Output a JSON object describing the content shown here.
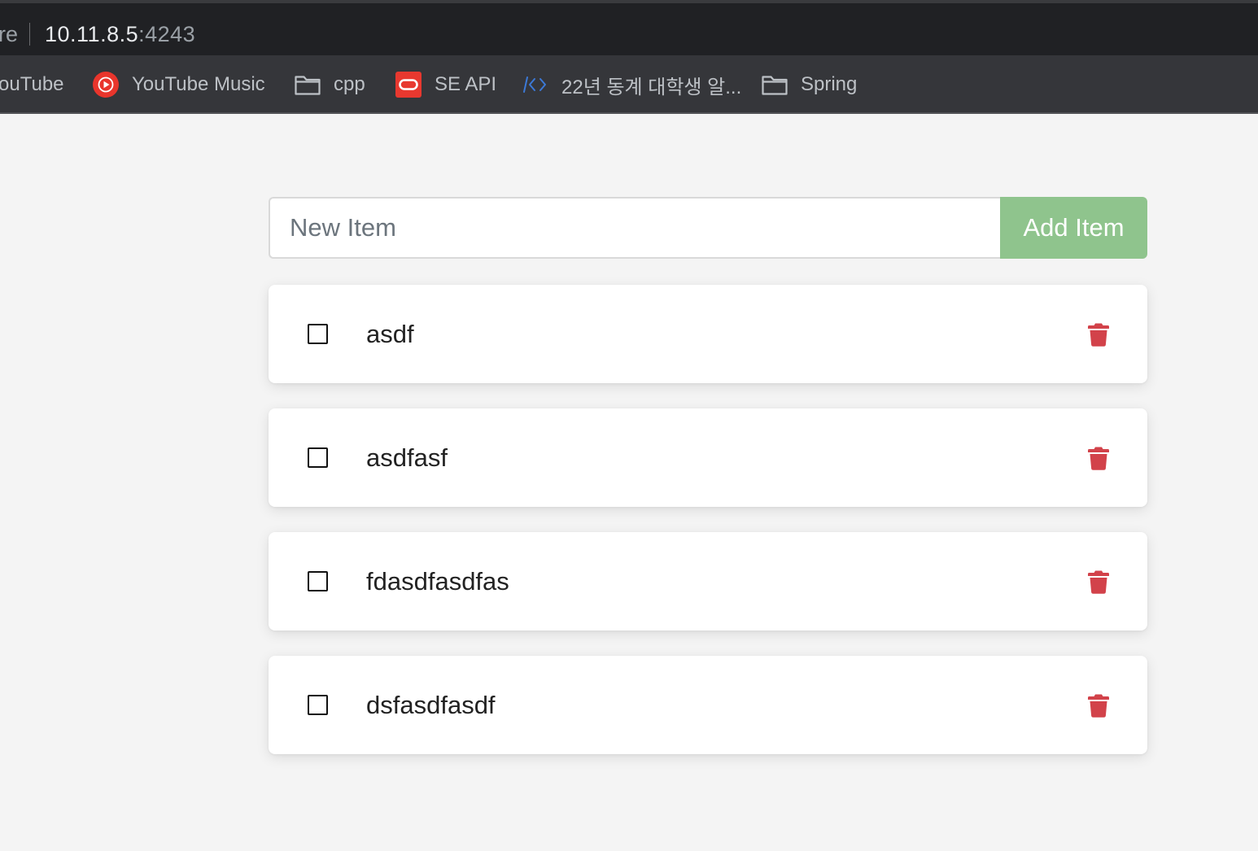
{
  "browser": {
    "url_prefix": "re",
    "url_host": "10.11.8.5",
    "url_port": ":4243",
    "bookmarks": [
      {
        "label": "ouTube",
        "icon": "none"
      },
      {
        "label": "YouTube Music",
        "icon": "youtube-music-icon"
      },
      {
        "label": "cpp",
        "icon": "folder-icon"
      },
      {
        "label": "SE API",
        "icon": "oracle-icon"
      },
      {
        "label": "22년 동계 대학생 알...",
        "icon": "code-brackets-icon"
      },
      {
        "label": "Spring",
        "icon": "folder-icon"
      }
    ]
  },
  "app": {
    "input_placeholder": "New Item",
    "input_value": "",
    "add_button_label": "Add Item",
    "items": [
      {
        "name": "asdf",
        "completed": false
      },
      {
        "name": "asdfasf",
        "completed": false
      },
      {
        "name": "fdasdfasdfas",
        "completed": false
      },
      {
        "name": "dsfasdfasdf",
        "completed": false
      }
    ]
  },
  "colors": {
    "add_button": "#8fc48d",
    "delete_icon": "#d2424a",
    "page_bg": "#f4f4f4",
    "chrome_dark": "#202124",
    "bookmarks_bar": "#35363a"
  }
}
